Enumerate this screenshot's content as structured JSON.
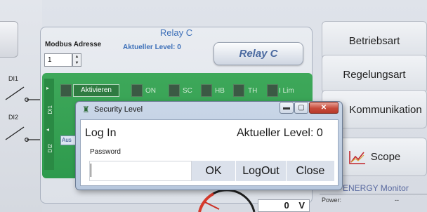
{
  "left_panel": {
    "di1_label": "DI1",
    "di2_label": "DI2"
  },
  "relay_panel": {
    "title": "Relay C",
    "modbus_label": "Modbus Adresse",
    "modbus_value": "1",
    "level_label": "Aktueller Level: 0",
    "relay_button_label": "Relay C",
    "activate_label": "Aktivieren",
    "status_labels": [
      "ON",
      "SC",
      "HB",
      "TH",
      "I Lim"
    ],
    "side_label_1": "DI1",
    "side_label_2": "DI2",
    "select_value": "Aus",
    "voltage_value": "0",
    "voltage_unit": "V"
  },
  "right_menu": {
    "items": [
      "Betriebsart",
      "Regelungsart",
      "Kommunikation",
      "Scope"
    ]
  },
  "energy_monitor": {
    "title": "ENERGY Monitor",
    "power_label": "Power:",
    "power_value": "--"
  },
  "dialog": {
    "title": "Security Level",
    "heading": "Log In",
    "level_text": "Aktueller Level: 0",
    "password_label": "Password",
    "password_value": "",
    "buttons": [
      "OK",
      "LogOut",
      "Close"
    ],
    "window_controls": {
      "minimize": "▬",
      "maximize": "▢",
      "close": "✕"
    }
  },
  "colors": {
    "accent_blue": "#3c6fb8",
    "relay_green": "#3ea85a",
    "dialog_frame": "#b7c7dd",
    "close_red": "#c74b3b"
  },
  "icons": {
    "dialog": "security-shield-icon",
    "scope": "scope-chart-icon"
  }
}
